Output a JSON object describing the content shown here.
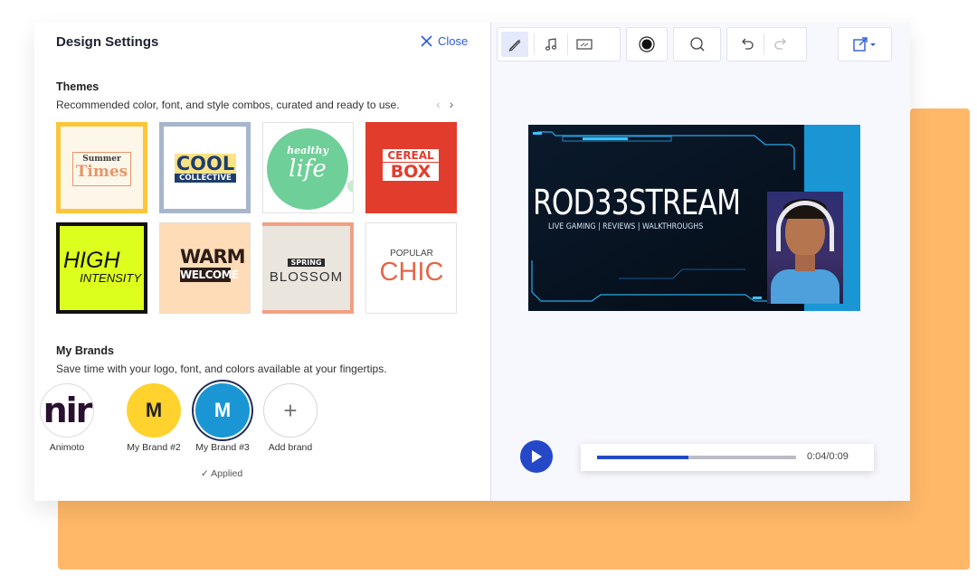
{
  "panel": {
    "title": "Design Settings",
    "close_label": "Close"
  },
  "themes": {
    "heading": "Themes",
    "description": "Recommended color, font, and style combos, curated and ready to use.",
    "items": [
      {
        "line1": "Summer",
        "line2": "Times"
      },
      {
        "line1": "COOL",
        "line2": "COLLECTIVE"
      },
      {
        "line1": "healthy",
        "line2": "life"
      },
      {
        "line1": "CEREAL",
        "line2": "BOX"
      },
      {
        "line1": "HIGH",
        "line2": "INTENSITY"
      },
      {
        "line1": "WARM",
        "line2": "WELCOME"
      },
      {
        "line1": "SPRING",
        "line2": "BLOSSOM"
      },
      {
        "line1": "POPULAR",
        "line2": "CHIC"
      }
    ]
  },
  "brands": {
    "heading": "My Brands",
    "description": "Save time with your logo, font, and colors available at your fingertips.",
    "items": [
      {
        "initial": "nir",
        "label": "Animoto"
      },
      {
        "initial": "M",
        "label": "My Brand #2"
      },
      {
        "initial": "M",
        "label": "My Brand #3"
      },
      {
        "initial": "+",
        "label": "Add brand"
      }
    ],
    "applied_label": "✓ Applied"
  },
  "preview": {
    "headline": "ROD33STREAM",
    "subline": "LIVE GAMING | REVIEWS | WALKTHROUGHS"
  },
  "player": {
    "time": "0:04/0:09",
    "progress": 0.46
  },
  "colors": {
    "accent": "#2e5bd8",
    "orange_bg": "#ffb868",
    "brand2": "#ffd22e",
    "brand3": "#1a96d4"
  }
}
